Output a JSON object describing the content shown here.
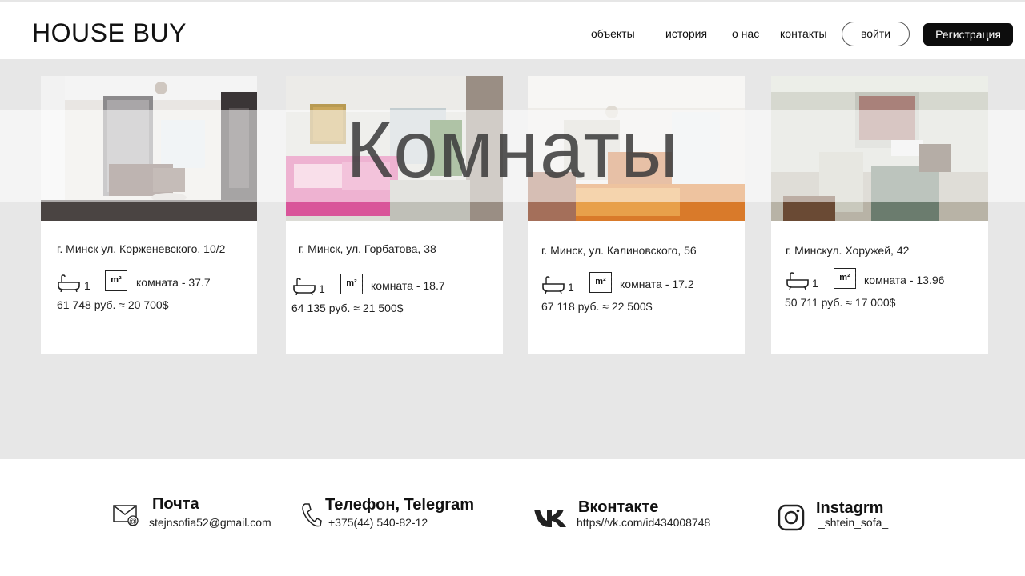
{
  "header": {
    "logo": "HOUSE BUY",
    "nav": [
      "объекты",
      "история",
      "о нас",
      "контакты"
    ],
    "login": "войти",
    "register": "Регистрация"
  },
  "banner": {
    "title": "Комнаты"
  },
  "listings": [
    {
      "address": "г. Минск ул. Корженевского, 10/2",
      "baths": "1",
      "area": "комната - 37.7",
      "price": "61 748 руб. ≈ 20 700$"
    },
    {
      "address": "г. Минск, ул. Горбатова, 38",
      "baths": "1",
      "area": "комната - 18.7",
      "price": "64 135 руб. ≈ 21 500$"
    },
    {
      "address": "г. Минск, ул. Калиновского, 56",
      "baths": "1",
      "area": "комната - 17.2",
      "price": "67 118 руб. ≈ 22 500$"
    },
    {
      "address": "г. Минскул. Хоружей, 42",
      "baths": "1",
      "area": "комната - 13.96",
      "price": "50 711 руб. ≈ 17 000$"
    }
  ],
  "area_unit": "m²",
  "footer": {
    "email": {
      "title": "Почта",
      "value": "stejnsofia52@gmail.com",
      "icon": "mail-icon"
    },
    "phone": {
      "title": "Телефон, Telegram",
      "value": "+375(44) 540-82-12",
      "icon": "phone-icon"
    },
    "vk": {
      "title": "Вконтакте",
      "value": "https//vk.com/id434008748",
      "icon": "vk-icon"
    },
    "instagram": {
      "title": "Instagrm",
      "value": "_shtein_sofa_",
      "icon": "instagram-icon"
    }
  }
}
